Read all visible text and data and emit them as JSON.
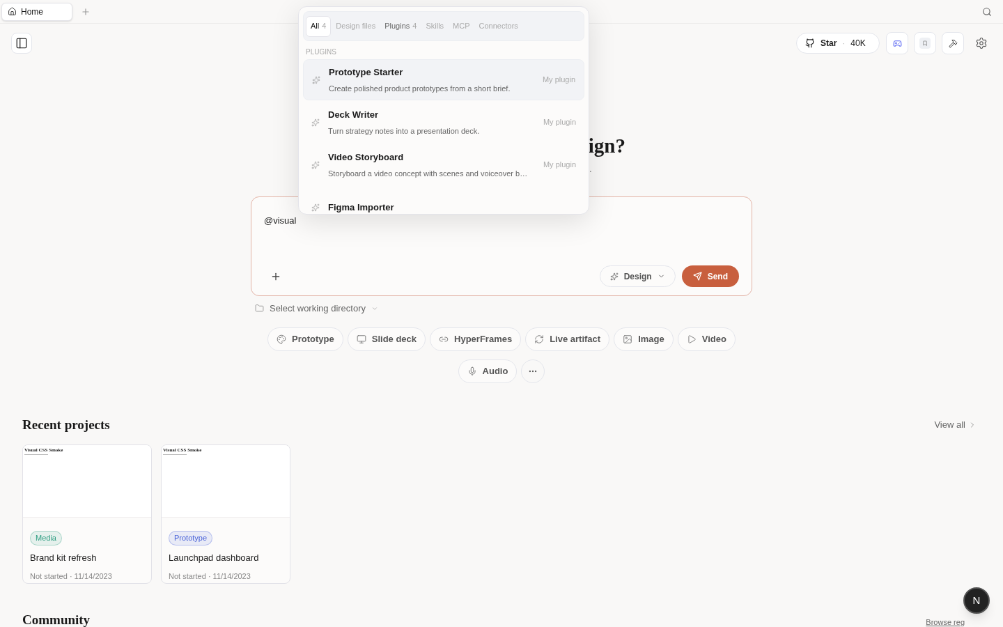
{
  "tabs": [
    {
      "label": "Home",
      "selected": true
    }
  ],
  "toolbar": {
    "star_label": "Star",
    "separator": "·",
    "star_count": "40K"
  },
  "heading_visible": "ign?",
  "subtitle_visible": ".",
  "composer": {
    "value": "@visual",
    "mode_label": "Design",
    "send_label": "Send"
  },
  "directory": {
    "label": "Select working directory"
  },
  "chips": [
    {
      "label": "Prototype",
      "kind": "palette"
    },
    {
      "label": "Slide deck",
      "kind": "monitor"
    },
    {
      "label": "HyperFrames",
      "kind": "link"
    },
    {
      "label": "Live artifact",
      "kind": "refresh"
    },
    {
      "label": "Image",
      "kind": "image"
    },
    {
      "label": "Video",
      "kind": "play"
    },
    {
      "label": "Audio",
      "kind": "mic"
    }
  ],
  "recent": {
    "title": "Recent projects",
    "meta_separator": "·",
    "view_all": "View all",
    "projects": [
      {
        "thumb_title": "Visual CSS Smoke",
        "tag": "Media",
        "color": "#2f9e82",
        "name": "Brand kit refresh",
        "status": "Not started",
        "date": "11/14/2023"
      },
      {
        "thumb_title": "Visual CSS Smoke",
        "tag": "Prototype",
        "color": "#4a63d8",
        "name": "Launchpad dashboard",
        "status": "Not started",
        "date": "11/14/2023"
      }
    ]
  },
  "community": {
    "title": "Community",
    "link": "Browse reg"
  },
  "avatar": "N",
  "mention_menu": {
    "tabs": [
      {
        "label": "All",
        "count": "4",
        "selected": true
      },
      {
        "label": "Design files",
        "selected": false
      },
      {
        "label": "Plugins",
        "count": "4",
        "selected": false
      },
      {
        "label": "Skills",
        "selected": false
      },
      {
        "label": "MCP",
        "selected": false
      },
      {
        "label": "Connectors",
        "selected": false
      }
    ],
    "section": "PLUGINS",
    "items": [
      {
        "title": "Prototype Starter",
        "description": "Create polished product prototypes from a short brief.",
        "badge": "My plugin",
        "selected": true
      },
      {
        "title": "Deck Writer",
        "description": "Turn strategy notes into a presentation deck.",
        "badge": "My plugin",
        "selected": false
      },
      {
        "title": "Video Storyboard",
        "description": "Storyboard a video concept with scenes and voiceover b…",
        "badge": "My plugin",
        "selected": false
      },
      {
        "title": "Figma Importer",
        "selected": false
      }
    ]
  }
}
